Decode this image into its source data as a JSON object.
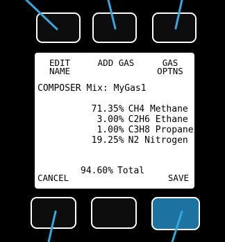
{
  "screen": {
    "softkeys": {
      "left": "EDIT\nNAME",
      "middle": "ADD GAS",
      "right": "GAS\nOPTNS"
    },
    "mode_label": "COMPOSER",
    "mix_text": "Mix: MyGas1",
    "components": [
      {
        "percent": "71.35%",
        "formula": "CH4",
        "name": "Methane"
      },
      {
        "percent": "3.00%",
        "formula": "C2H6",
        "name": "Ethane"
      },
      {
        "percent": "1.00%",
        "formula": "C3H8",
        "name": "Propane"
      },
      {
        "percent": "19.25%",
        "formula": "N2",
        "name": "Nitrogen"
      }
    ],
    "total_percent": "94.60%",
    "total_label": "Total",
    "cancel_label": "CANCEL",
    "save_label": "SAVE"
  },
  "colors": {
    "background": "#000000",
    "screen": "#ffffff",
    "save_button": "#1c73a0"
  }
}
